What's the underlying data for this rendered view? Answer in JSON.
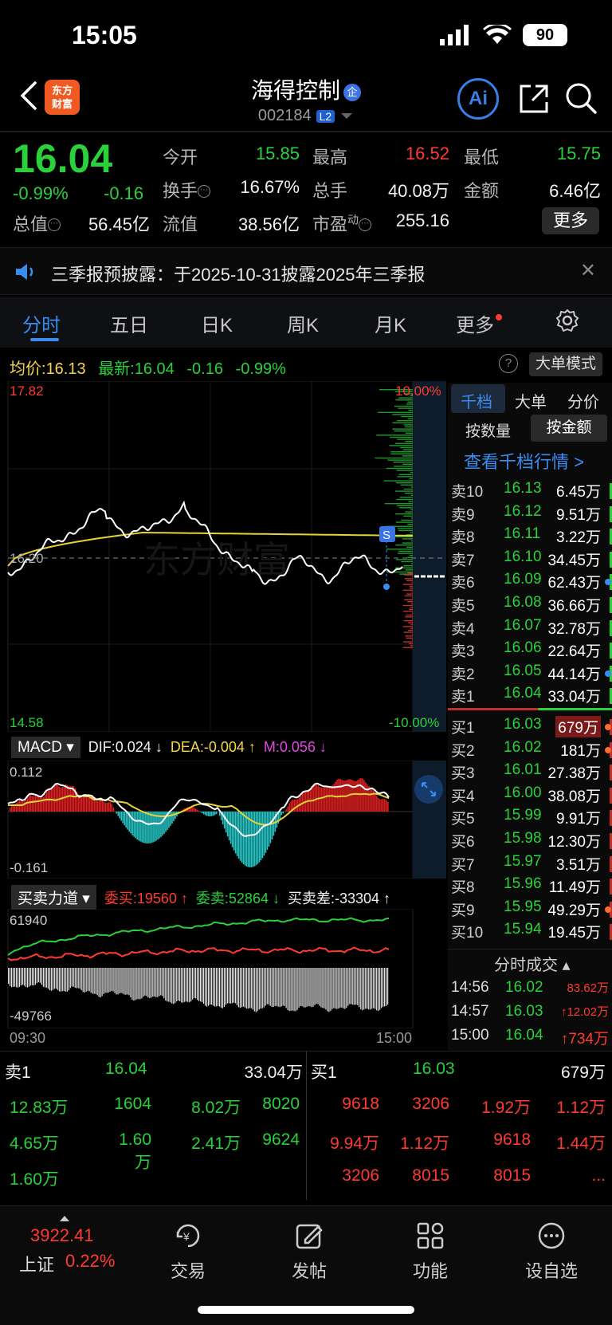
{
  "status": {
    "time": "15:05",
    "battery": "90"
  },
  "header": {
    "name": "海得控制",
    "badge": "企",
    "code": "002184",
    "level": "L2",
    "logo_line1": "东方",
    "logo_line2": "财富",
    "ai_label": "Ai"
  },
  "quote": {
    "price": "16.04",
    "pct": "-0.99%",
    "change": "-0.16",
    "fields": [
      {
        "label": "今开",
        "value": "15.85",
        "color": "#2ad13a"
      },
      {
        "label": "最高",
        "value": "16.52",
        "color": "#ff3b30"
      },
      {
        "label": "最低",
        "value": "15.75",
        "color": "#2ad13a"
      },
      {
        "label": "换手",
        "value": "16.67%",
        "color": "#f0f0f0"
      },
      {
        "label": "总手",
        "value": "40.08万",
        "color": "#f0f0f0"
      },
      {
        "label": "金额",
        "value": "6.46亿",
        "color": "#f0f0f0"
      },
      {
        "label": "总值",
        "value": "56.45亿",
        "color": "#f0f0f0"
      },
      {
        "label": "流值",
        "value": "38.56亿",
        "color": "#f0f0f0"
      },
      {
        "label": "市盈",
        "value": "255.16",
        "color": "#f0f0f0"
      }
    ],
    "pe_super": "动",
    "more": "更多"
  },
  "announcement": "三季报预披露：于2025-10-31披露2025年三季报",
  "tabs": [
    "分时",
    "五日",
    "日K",
    "周K",
    "月K",
    "更多"
  ],
  "chart_info": {
    "avg_label": "均价:",
    "avg": "16.13",
    "latest_label": "最新:",
    "latest": "16.04",
    "chg": "-0.16",
    "pct": "-0.99%",
    "bigorder": "大单模式",
    "help": "?"
  },
  "price_chart": {
    "top": "17.82",
    "bottom": "14.58",
    "ref": "16.20",
    "top_pct": "10.00%",
    "bottom_pct": "-10.00%",
    "signal": "S",
    "watermark": "东方财富"
  },
  "macd": {
    "title": "MACD",
    "dif": "DIF:0.024 ↓",
    "dea": "DEA:-0.004 ↑",
    "m": "M:0.056 ↓",
    "max": "0.112",
    "min": "-0.161"
  },
  "force": {
    "title": "买卖力道",
    "buy": "委买:19560 ↑",
    "sell": "委卖:52864 ↓",
    "diff": "买卖差:-33304 ↑",
    "max": "61940",
    "min": "-49766",
    "t_start": "09:30",
    "t_end": "15:00"
  },
  "orderbook": {
    "tabs": [
      "千档",
      "大单",
      "分价"
    ],
    "toggle": [
      "按数量",
      "按金额"
    ],
    "link": "查看千档行情 >",
    "asks": [
      {
        "label": "卖10",
        "price": "16.13",
        "vol": "6.45万"
      },
      {
        "label": "卖9",
        "price": "16.12",
        "vol": "9.51万"
      },
      {
        "label": "卖8",
        "price": "16.11",
        "vol": "3.22万"
      },
      {
        "label": "卖7",
        "price": "16.10",
        "vol": "34.45万"
      },
      {
        "label": "卖6",
        "price": "16.09",
        "vol": "62.43万"
      },
      {
        "label": "卖5",
        "price": "16.08",
        "vol": "36.66万"
      },
      {
        "label": "卖4",
        "price": "16.07",
        "vol": "32.78万"
      },
      {
        "label": "卖3",
        "price": "16.06",
        "vol": "22.64万"
      },
      {
        "label": "卖2",
        "price": "16.05",
        "vol": "44.14万"
      },
      {
        "label": "卖1",
        "price": "16.04",
        "vol": "33.04万"
      }
    ],
    "bids": [
      {
        "label": "买1",
        "price": "16.03",
        "vol": "679万"
      },
      {
        "label": "买2",
        "price": "16.02",
        "vol": "181万"
      },
      {
        "label": "买3",
        "price": "16.01",
        "vol": "27.38万"
      },
      {
        "label": "买4",
        "price": "16.00",
        "vol": "38.08万"
      },
      {
        "label": "买5",
        "price": "15.99",
        "vol": "9.91万"
      },
      {
        "label": "买6",
        "price": "15.98",
        "vol": "12.30万"
      },
      {
        "label": "买7",
        "price": "15.97",
        "vol": "3.51万"
      },
      {
        "label": "买8",
        "price": "15.96",
        "vol": "11.49万"
      },
      {
        "label": "买9",
        "price": "15.95",
        "vol": "49.29万"
      },
      {
        "label": "买10",
        "price": "15.94",
        "vol": "19.45万"
      }
    ],
    "ticks_title": "分时成交",
    "ticks": [
      {
        "time": "14:56",
        "price": "16.02",
        "vol": "83.62万"
      },
      {
        "time": "14:57",
        "price": "16.03",
        "vol": "↑12.02万"
      },
      {
        "time": "15:00",
        "price": "16.04",
        "vol": "↑734万"
      }
    ]
  },
  "bottom_trades": {
    "sell_label": "卖1",
    "sell_price": "16.04",
    "sell_vol": "33.04万",
    "buy_label": "买1",
    "buy_price": "16.03",
    "buy_vol": "679万",
    "sell_rows": [
      [
        "12.83万",
        "1604",
        "8.02万",
        "8020"
      ],
      [
        "4.65万",
        "1.60万",
        "2.41万",
        "9624"
      ],
      [
        "1.60万",
        "",
        "",
        ""
      ]
    ],
    "buy_rows": [
      [
        "9618",
        "3206",
        "1.92万",
        "1.12万"
      ],
      [
        "9.94万",
        "1.12万",
        "9618",
        "1.44万"
      ],
      [
        "3206",
        "8015",
        "8015",
        "..."
      ]
    ]
  },
  "nav": {
    "index_value": "3922.41",
    "index_name": "上证",
    "index_pct": "0.22%",
    "items": [
      "交易",
      "发帖",
      "功能",
      "设自选"
    ]
  }
}
